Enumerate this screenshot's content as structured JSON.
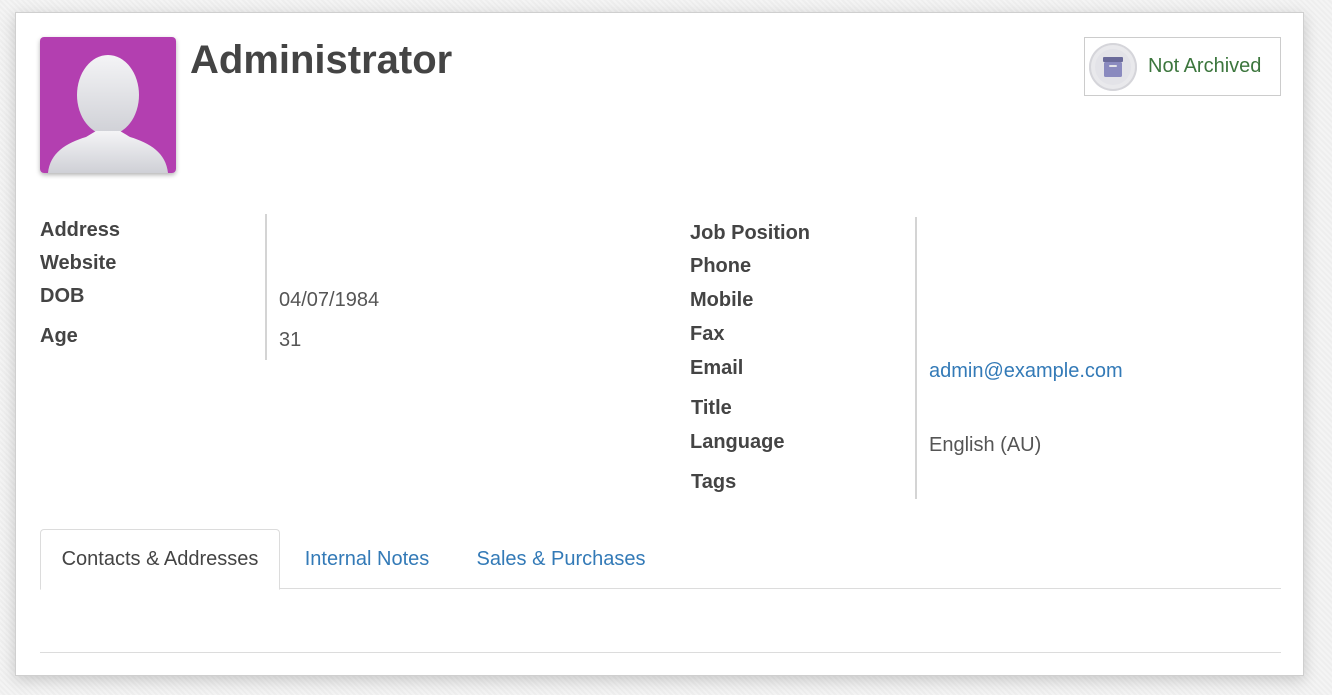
{
  "record": {
    "name": "Administrator",
    "avatar_icon": "default-user-avatar",
    "avatar_bg": "#b33fb0"
  },
  "archive": {
    "label": "Not Archived",
    "icon": "archive-box-icon",
    "color": "#3c763d"
  },
  "left_fields": {
    "address_label": "Address",
    "website_label": "Website",
    "dob_label": "DOB",
    "dob_value": "04/07/1984",
    "age_label": "Age",
    "age_value": "31"
  },
  "right_fields": {
    "job_position_label": "Job Position",
    "phone_label": "Phone",
    "mobile_label": "Mobile",
    "fax_label": "Fax",
    "email_label": "Email",
    "email_value": "admin@example.com",
    "title_label": "Title",
    "language_label": "Language",
    "language_value": "English (AU)",
    "tags_label": "Tags"
  },
  "tabs": [
    {
      "label": "Contacts & Addresses",
      "active": true
    },
    {
      "label": "Internal Notes",
      "active": false
    },
    {
      "label": "Sales & Purchases",
      "active": false
    }
  ],
  "colors": {
    "link": "#337ab7",
    "archive_text": "#3c763d"
  }
}
